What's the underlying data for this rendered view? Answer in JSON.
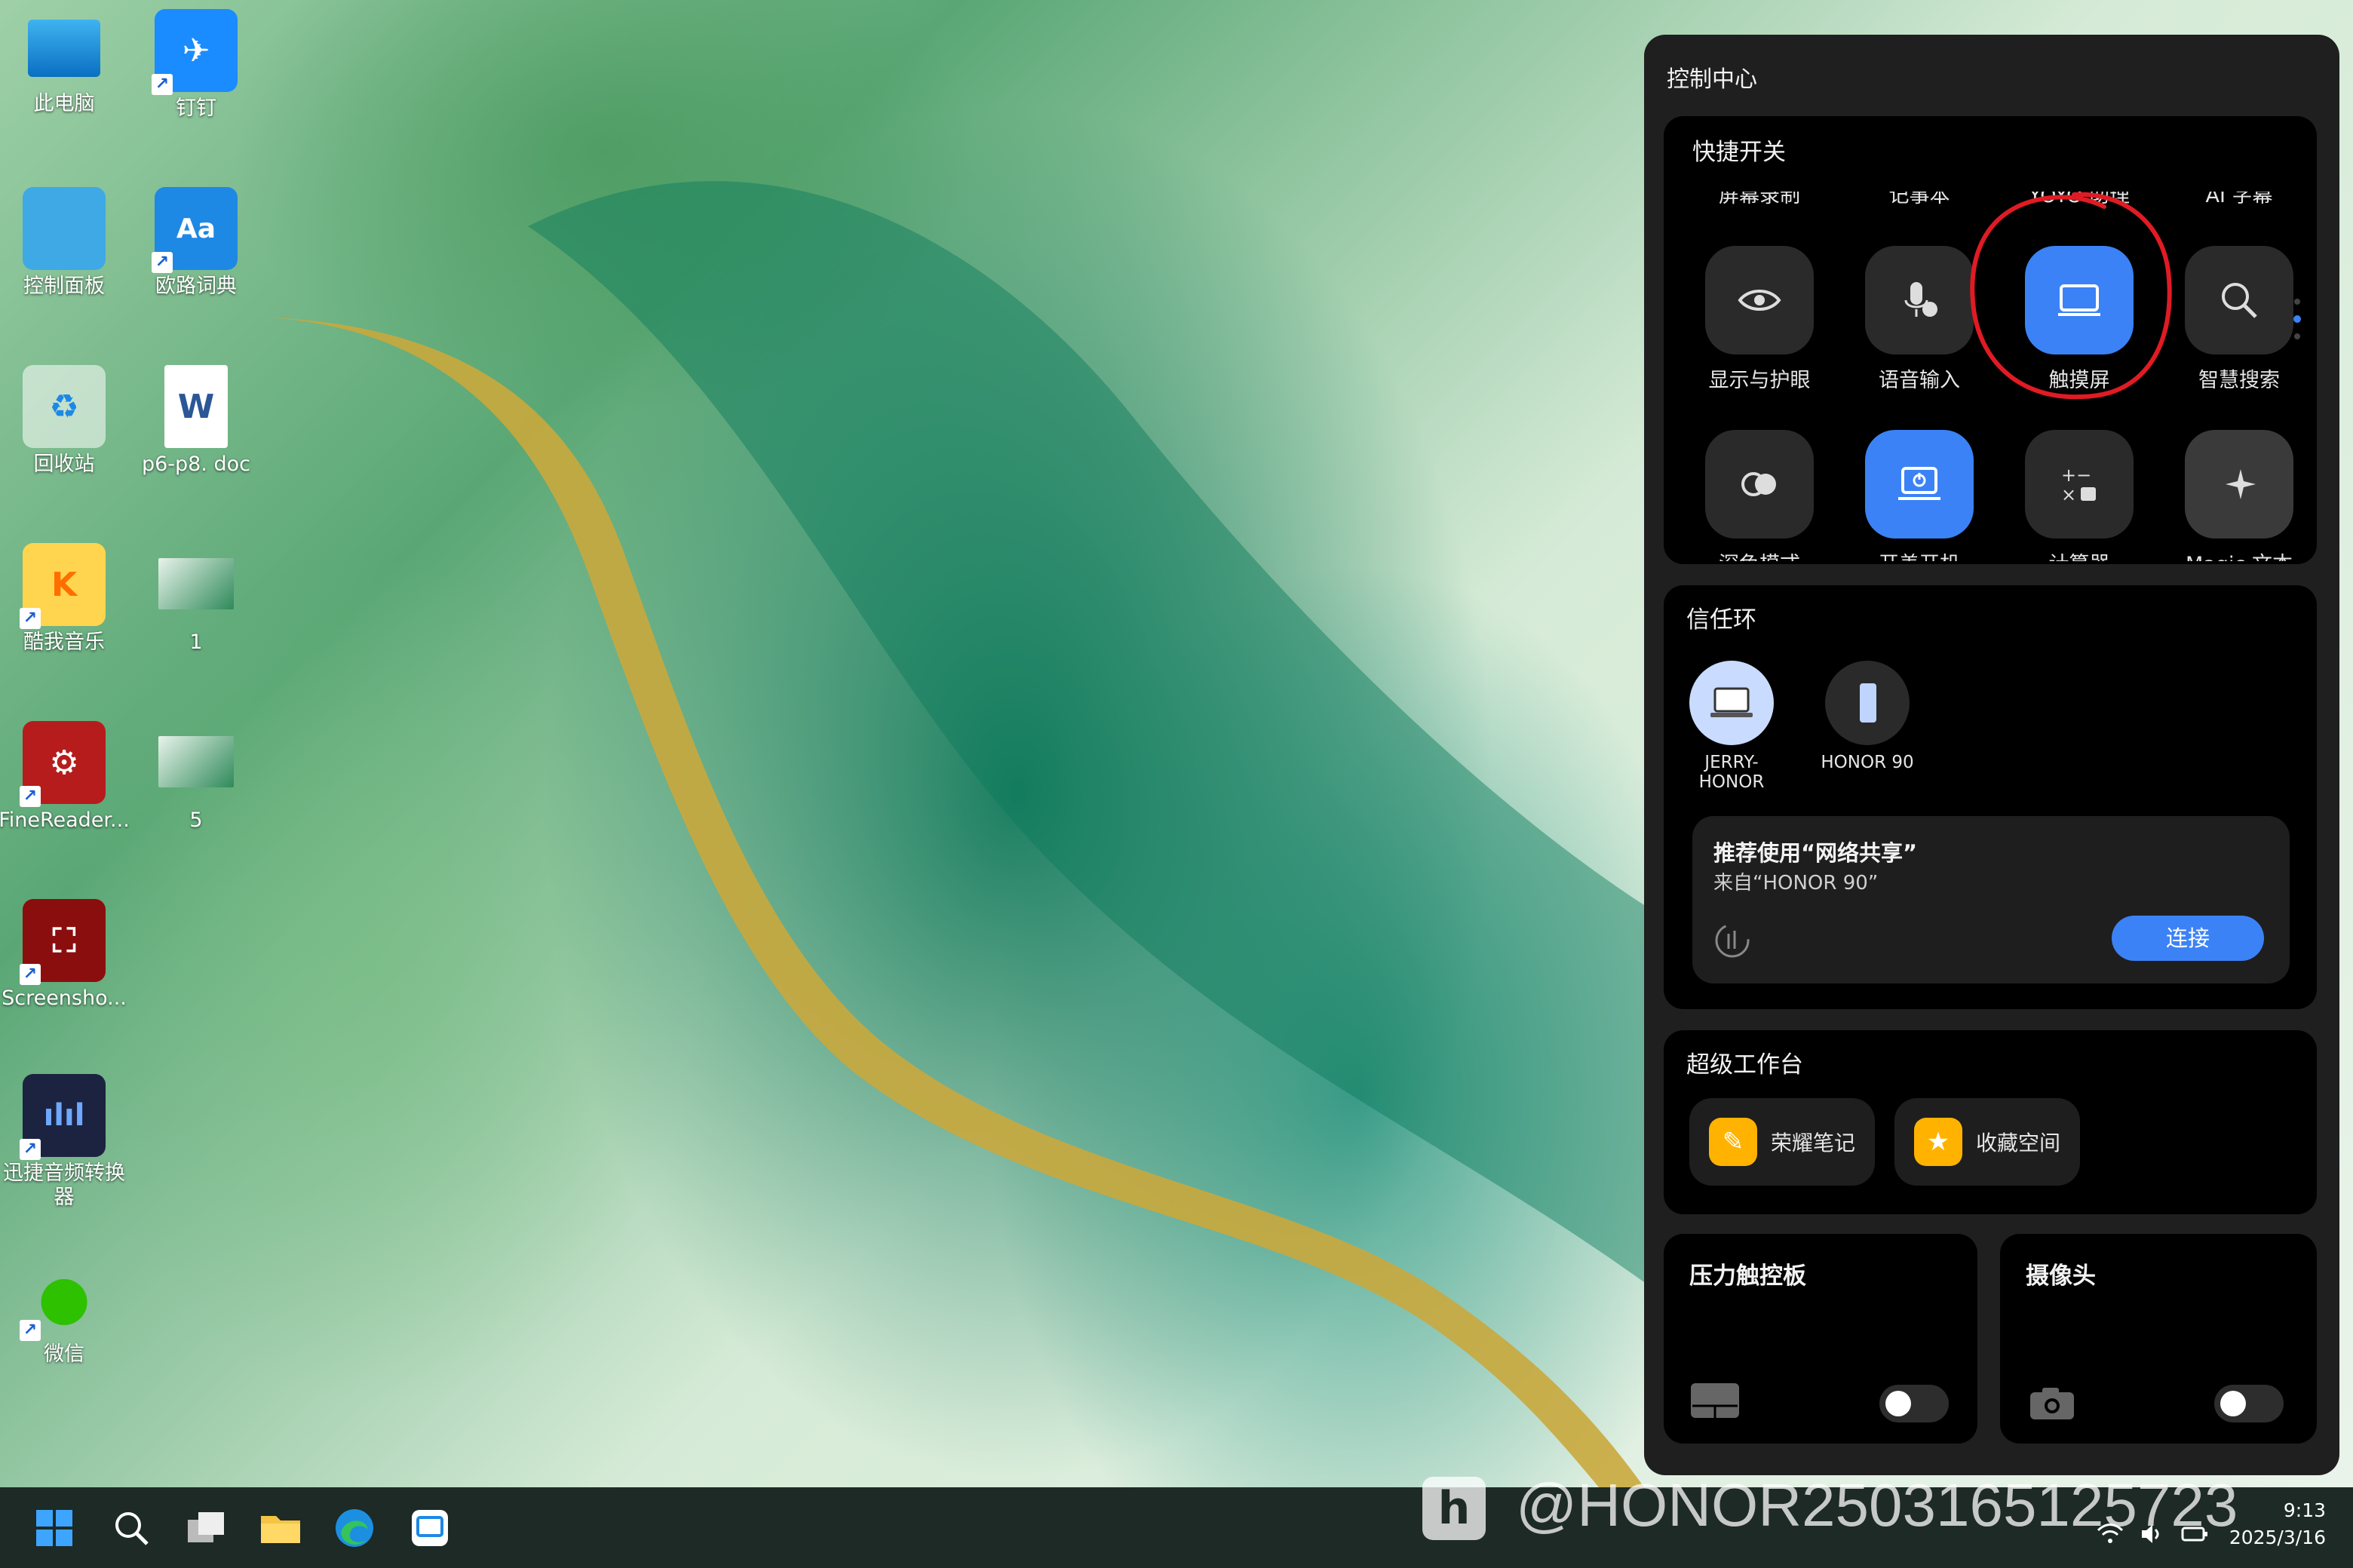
{
  "desktop": {
    "icons": [
      {
        "label": "此电脑",
        "icon": "computer-icon"
      },
      {
        "label": "钉钉",
        "icon": "dingtalk-icon"
      },
      {
        "label": "控制面板",
        "icon": "control-panel-icon"
      },
      {
        "label": "欧路词典",
        "icon": "eudic-icon"
      },
      {
        "label": "回收站",
        "icon": "recycle-bin-icon"
      },
      {
        "label": "p6-p8. doc",
        "icon": "word-doc-icon"
      },
      {
        "label": "酷我音乐",
        "icon": "kuwo-music-icon"
      },
      {
        "label": "1",
        "icon": "image-file-icon"
      },
      {
        "label": "FineReader...",
        "icon": "finereader-icon"
      },
      {
        "label": "5",
        "icon": "image-file-icon"
      },
      {
        "label": "Screensho...",
        "icon": "screenshot-tool-icon"
      },
      {
        "label": "迅捷音频转换器",
        "icon": "audio-converter-icon"
      },
      {
        "label": "微信",
        "icon": "wechat-icon"
      }
    ]
  },
  "control_center": {
    "title": "控制中心",
    "quick_toggles": {
      "title": "快捷开关",
      "clipped_top_labels": [
        "屏幕录制",
        "记事本",
        "YOYO 助理",
        "AI 字幕"
      ],
      "row1": [
        {
          "label": "显示与护眼",
          "icon": "eye-icon",
          "active": false
        },
        {
          "label": "语音输入",
          "icon": "microphone-icon",
          "active": false
        },
        {
          "label": "触摸屏",
          "icon": "laptop-screen-icon",
          "active": true
        },
        {
          "label": "智慧搜索",
          "icon": "search-icon",
          "active": false
        }
      ],
      "row2": [
        {
          "label": "深色模式",
          "icon": "dark-mode-icon",
          "active": false
        },
        {
          "label": "开盖开机",
          "icon": "lid-power-icon",
          "active": true
        },
        {
          "label": "计算器",
          "icon": "calculator-icon",
          "active": false
        },
        {
          "label": "Magic 文本",
          "icon": "sparkle-icon",
          "active": false
        }
      ]
    },
    "trust_ring": {
      "title": "信任环",
      "devices": [
        {
          "label": "JERRY-\nHONOR",
          "icon": "laptop-icon"
        },
        {
          "label": "HONOR 90",
          "icon": "phone-icon"
        }
      ],
      "recommendation": {
        "title": "推荐使用“网络共享”",
        "subtitle": "来自“HONOR 90”",
        "button": "连接",
        "icon": "hotspot-icon"
      }
    },
    "workstation": {
      "title": "超级工作台",
      "apps": [
        {
          "label": "荣耀笔记",
          "icon": "notes-icon"
        },
        {
          "label": "收藏空间",
          "icon": "favorites-icon"
        }
      ]
    },
    "pressure_touchpad": {
      "title": "压力触控板",
      "icon": "touchpad-icon",
      "on": false
    },
    "camera": {
      "title": "摄像头",
      "icon": "camera-icon",
      "on": false
    }
  },
  "taskbar": {
    "icons": [
      "start-icon",
      "search-icon",
      "task-view-icon",
      "file-explorer-icon",
      "edge-icon",
      "app-icon"
    ],
    "watermark": "@HONOR2503165125723",
    "time": "9:13",
    "date": "2025/3/16"
  },
  "colors": {
    "accent": "#3b82f6",
    "panel": "#1f1f1f",
    "card": "#000000",
    "annotation": "#e01b24"
  }
}
